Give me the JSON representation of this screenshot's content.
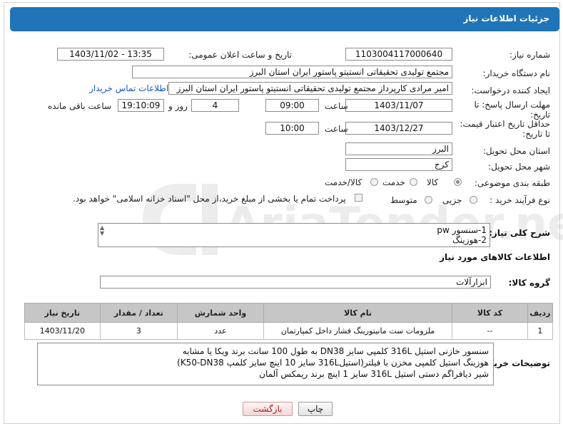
{
  "page": {
    "title": "جزئیات اطلاعات نیاز",
    "colors": {
      "header": "#1f75b7",
      "link": "#1a55c5"
    }
  },
  "fields": {
    "need_number_label": "شماره نیاز:",
    "need_number": "1103004117000640",
    "announce_label": "تاریخ و ساعت اعلان عمومی:",
    "announce_value": "1403/11/02 - 13:35",
    "buyer_org_label": "نام دستگاه خریدار:",
    "buyer_org": "مجتمع تولیدی تحقیقاتی انستیتو پاستور ایران استان البرز",
    "requester_label": "ایجاد کننده درخواست:",
    "requester": "امیر مرادی کارپرداز مجتمع تولیدی تحقیقاتی انستیتو پاستور ایران استان البرز",
    "contact_link": "اطلاعات تماس خریدار",
    "deadline_label": "مهلت ارسال پاسخ: تا تاریخ:",
    "deadline_date": "1403/11/07",
    "time_label": "ساعت",
    "deadline_time": "09:00",
    "days_value": "4",
    "days_label": "روز و",
    "remaining_time": "19:10:09",
    "remaining_label": "ساعت باقی مانده",
    "validity_label": "حداقل تاریخ اعتبار قیمت: تا تاریخ:",
    "validity_date": "1403/12/27",
    "validity_time_label": "ساعت",
    "validity_time": "10:00",
    "province_label": "استان محل تحویل:",
    "province": "البرز",
    "city_label": "شهر محل تحویل:",
    "city": "کرج",
    "category_label": "طبقه بندی موضوعی:",
    "category_options": [
      "کالا",
      "خدمت",
      "کالا/خدمت"
    ],
    "category_selected": "کالا",
    "process_label": "نوع فرآیند خرید :",
    "process_options": [
      "جزیی",
      "متوسط"
    ],
    "payment_note": "پرداخت تمام یا بخشی از مبلغ خرید،از محل \"اسناد خزانه اسلامی\" خواهد بود."
  },
  "description": {
    "label": "شرح کلی نیاز:",
    "lines": [
      "1-سنسور pw",
      "2-هوزینگ"
    ]
  },
  "goods": {
    "section_title": "اطلاعات کالاهای مورد نیاز",
    "group_label": "گروه کالا:",
    "group_value": "ابزارآلات",
    "columns": [
      "ردیف",
      "کد کالا",
      "نام کالا",
      "واحد شمارش",
      "تعداد / مقدار",
      "تاریخ نیاز"
    ],
    "rows": [
      {
        "row": "1",
        "code": "--",
        "name": "ملزومات ست مانیتورینگ فشار داخل کمپارتمان",
        "unit": "عدد",
        "qty": "3",
        "date": "1403/11/20"
      }
    ]
  },
  "buyer_notes": {
    "label": "توضیحات خریدار:",
    "lines": [
      "سنسور خازنی استیل 316L کلمپی سایز DN38 به طول 100 سانت برند ویکا یا مشابه",
      "هوزینگ استیل کلمپی مخزن با فیلتر(استیل316L سایز 10 اینچ سایز کلمپ K50-DN38)",
      "شیر دیافراگم دستی استیل 316L سایز 1 اینچ برند ریمکس آلمان"
    ]
  },
  "buttons": {
    "print": "چاپ",
    "back": "بازگشت"
  },
  "watermark": {
    "text": "AriaTender.neT"
  }
}
